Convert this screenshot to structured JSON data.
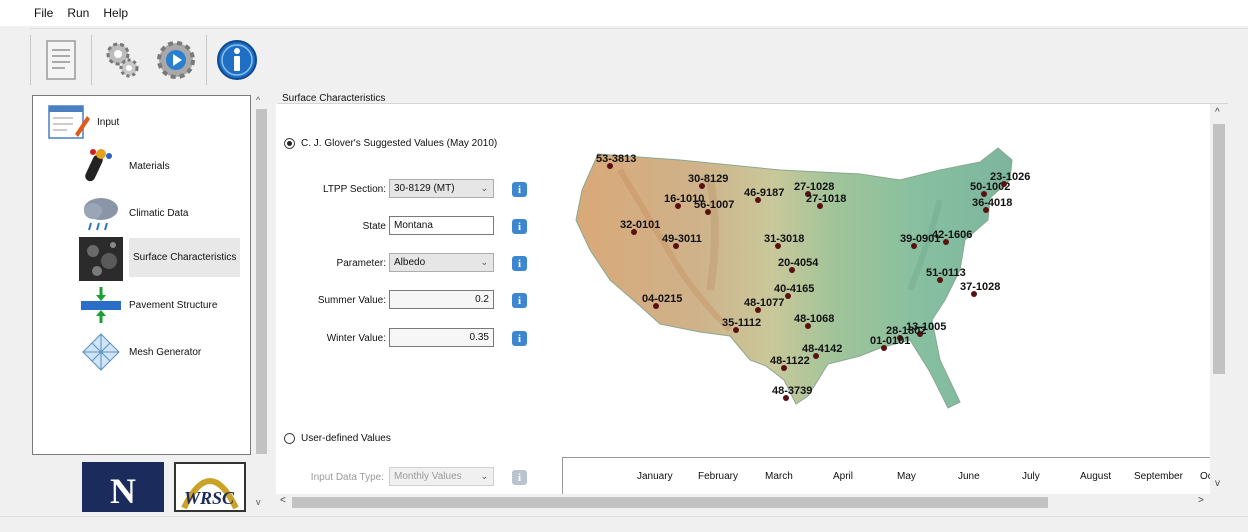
{
  "menu": {
    "file": "File",
    "run": "Run",
    "help": "Help"
  },
  "nav": {
    "input": "Input",
    "materials": "Materials",
    "climatic": "Climatic Data",
    "surface": "Surface Characteristics",
    "pavement": "Pavement Structure",
    "mesh": "Mesh Generator"
  },
  "logos": {
    "n": "N",
    "wrsc": "WRSC"
  },
  "section": {
    "title": "Surface Characteristics"
  },
  "suggested": {
    "radio_label": "C. J. Glover's Suggested Values (May 2010)",
    "ltpp_label": "LTPP Section:",
    "ltpp_value": "30-8129 (MT)",
    "state_label": "State",
    "state_value": "Montana",
    "param_label": "Parameter:",
    "param_value": "Albedo",
    "summer_label": "Summer Value:",
    "summer_value": "0.2",
    "winter_label": "Winter Value:",
    "winter_value": "0.35"
  },
  "user_defined": {
    "radio_label": "User-defined Values",
    "input_type_label": "Input Data Type:",
    "input_type_value": "Monthly Values"
  },
  "months": [
    "January",
    "February",
    "March",
    "April",
    "May",
    "June",
    "July",
    "August",
    "September",
    "Oc"
  ],
  "map_sites": [
    "53-3813",
    "30-8129",
    "16-1010",
    "56-1007",
    "46-9187",
    "27-1028",
    "27-1018",
    "50-1002",
    "23-1026",
    "36-4018",
    "32-0101",
    "49-3011",
    "31-3018",
    "39-0901",
    "42-1606",
    "20-4054",
    "51-0113",
    "40-4165",
    "37-1028",
    "04-0215",
    "48-1077",
    "35-1112",
    "48-1068",
    "13-1005",
    "28-1802",
    "01-0101",
    "48-4142",
    "48-1122",
    "48-3739"
  ],
  "icons": {
    "toolbar": [
      "document-icon",
      "gears-icon",
      "run-gear-icon",
      "info-icon"
    ]
  },
  "colors": {
    "info_blue": "#3d86d0",
    "site_dot": "#5a1010",
    "logo_navy": "#1b2c5c"
  }
}
